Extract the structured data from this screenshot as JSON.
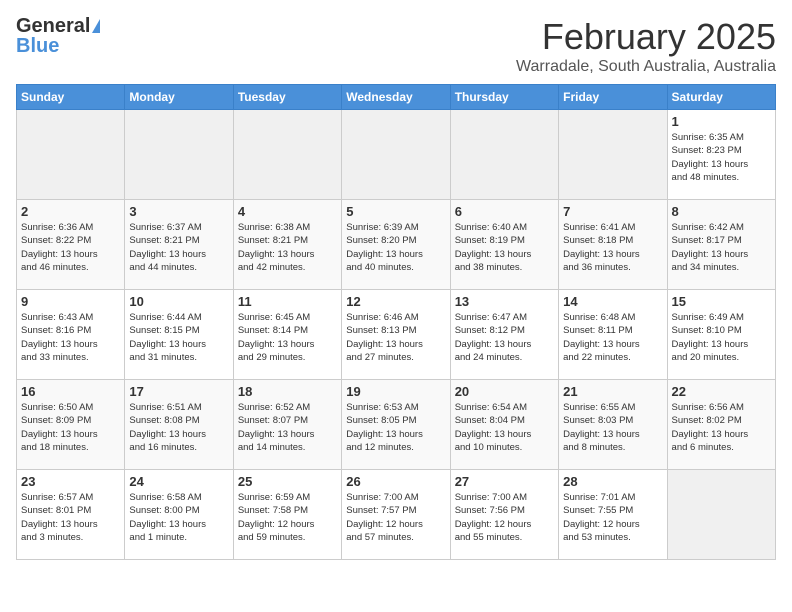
{
  "header": {
    "logo_general": "General",
    "logo_blue": "Blue",
    "month": "February 2025",
    "location": "Warradale, South Australia, Australia"
  },
  "days_of_week": [
    "Sunday",
    "Monday",
    "Tuesday",
    "Wednesday",
    "Thursday",
    "Friday",
    "Saturday"
  ],
  "weeks": [
    [
      {
        "num": "",
        "info": ""
      },
      {
        "num": "",
        "info": ""
      },
      {
        "num": "",
        "info": ""
      },
      {
        "num": "",
        "info": ""
      },
      {
        "num": "",
        "info": ""
      },
      {
        "num": "",
        "info": ""
      },
      {
        "num": "1",
        "info": "Sunrise: 6:35 AM\nSunset: 8:23 PM\nDaylight: 13 hours\nand 48 minutes."
      }
    ],
    [
      {
        "num": "2",
        "info": "Sunrise: 6:36 AM\nSunset: 8:22 PM\nDaylight: 13 hours\nand 46 minutes."
      },
      {
        "num": "3",
        "info": "Sunrise: 6:37 AM\nSunset: 8:21 PM\nDaylight: 13 hours\nand 44 minutes."
      },
      {
        "num": "4",
        "info": "Sunrise: 6:38 AM\nSunset: 8:21 PM\nDaylight: 13 hours\nand 42 minutes."
      },
      {
        "num": "5",
        "info": "Sunrise: 6:39 AM\nSunset: 8:20 PM\nDaylight: 13 hours\nand 40 minutes."
      },
      {
        "num": "6",
        "info": "Sunrise: 6:40 AM\nSunset: 8:19 PM\nDaylight: 13 hours\nand 38 minutes."
      },
      {
        "num": "7",
        "info": "Sunrise: 6:41 AM\nSunset: 8:18 PM\nDaylight: 13 hours\nand 36 minutes."
      },
      {
        "num": "8",
        "info": "Sunrise: 6:42 AM\nSunset: 8:17 PM\nDaylight: 13 hours\nand 34 minutes."
      }
    ],
    [
      {
        "num": "9",
        "info": "Sunrise: 6:43 AM\nSunset: 8:16 PM\nDaylight: 13 hours\nand 33 minutes."
      },
      {
        "num": "10",
        "info": "Sunrise: 6:44 AM\nSunset: 8:15 PM\nDaylight: 13 hours\nand 31 minutes."
      },
      {
        "num": "11",
        "info": "Sunrise: 6:45 AM\nSunset: 8:14 PM\nDaylight: 13 hours\nand 29 minutes."
      },
      {
        "num": "12",
        "info": "Sunrise: 6:46 AM\nSunset: 8:13 PM\nDaylight: 13 hours\nand 27 minutes."
      },
      {
        "num": "13",
        "info": "Sunrise: 6:47 AM\nSunset: 8:12 PM\nDaylight: 13 hours\nand 24 minutes."
      },
      {
        "num": "14",
        "info": "Sunrise: 6:48 AM\nSunset: 8:11 PM\nDaylight: 13 hours\nand 22 minutes."
      },
      {
        "num": "15",
        "info": "Sunrise: 6:49 AM\nSunset: 8:10 PM\nDaylight: 13 hours\nand 20 minutes."
      }
    ],
    [
      {
        "num": "16",
        "info": "Sunrise: 6:50 AM\nSunset: 8:09 PM\nDaylight: 13 hours\nand 18 minutes."
      },
      {
        "num": "17",
        "info": "Sunrise: 6:51 AM\nSunset: 8:08 PM\nDaylight: 13 hours\nand 16 minutes."
      },
      {
        "num": "18",
        "info": "Sunrise: 6:52 AM\nSunset: 8:07 PM\nDaylight: 13 hours\nand 14 minutes."
      },
      {
        "num": "19",
        "info": "Sunrise: 6:53 AM\nSunset: 8:05 PM\nDaylight: 13 hours\nand 12 minutes."
      },
      {
        "num": "20",
        "info": "Sunrise: 6:54 AM\nSunset: 8:04 PM\nDaylight: 13 hours\nand 10 minutes."
      },
      {
        "num": "21",
        "info": "Sunrise: 6:55 AM\nSunset: 8:03 PM\nDaylight: 13 hours\nand 8 minutes."
      },
      {
        "num": "22",
        "info": "Sunrise: 6:56 AM\nSunset: 8:02 PM\nDaylight: 13 hours\nand 6 minutes."
      }
    ],
    [
      {
        "num": "23",
        "info": "Sunrise: 6:57 AM\nSunset: 8:01 PM\nDaylight: 13 hours\nand 3 minutes."
      },
      {
        "num": "24",
        "info": "Sunrise: 6:58 AM\nSunset: 8:00 PM\nDaylight: 13 hours\nand 1 minute."
      },
      {
        "num": "25",
        "info": "Sunrise: 6:59 AM\nSunset: 7:58 PM\nDaylight: 12 hours\nand 59 minutes."
      },
      {
        "num": "26",
        "info": "Sunrise: 7:00 AM\nSunset: 7:57 PM\nDaylight: 12 hours\nand 57 minutes."
      },
      {
        "num": "27",
        "info": "Sunrise: 7:00 AM\nSunset: 7:56 PM\nDaylight: 12 hours\nand 55 minutes."
      },
      {
        "num": "28",
        "info": "Sunrise: 7:01 AM\nSunset: 7:55 PM\nDaylight: 12 hours\nand 53 minutes."
      },
      {
        "num": "",
        "info": ""
      }
    ]
  ]
}
